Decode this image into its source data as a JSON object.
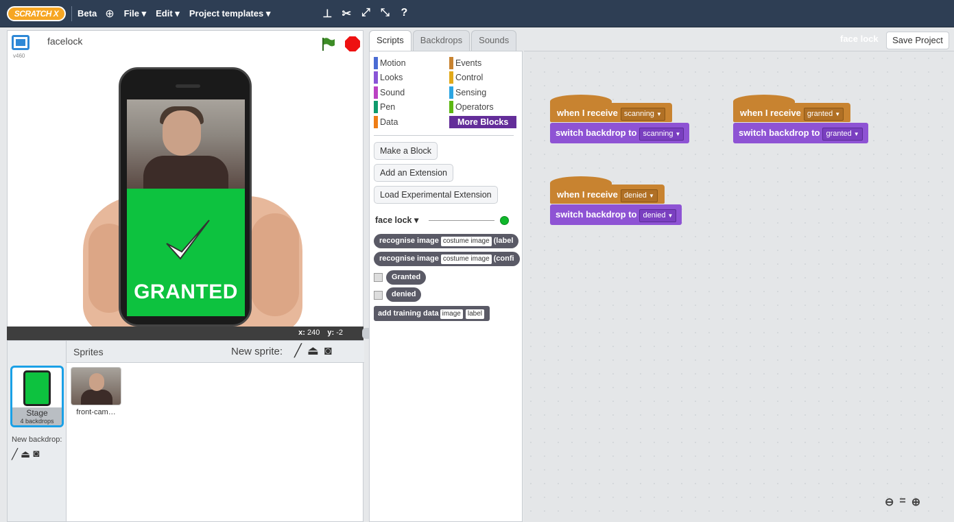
{
  "topbar": {
    "logo": "SCRATCH X",
    "beta": "Beta",
    "menus": [
      "File ▾",
      "Edit ▾",
      "Project templates ▾"
    ]
  },
  "stage": {
    "project_title": "facelock",
    "version": "v460",
    "coords": {
      "x_label": "x:",
      "x_value": "240",
      "y_label": "y:",
      "y_value": "-2"
    },
    "granted_text": "GRANTED"
  },
  "sprites_panel": {
    "title": "Sprites",
    "new_sprite": "New sprite:",
    "stage_tile": {
      "name": "Stage",
      "subtitle": "4 backdrops"
    },
    "new_backdrop": "New backdrop:",
    "sprites": [
      {
        "name": "front-cam…"
      }
    ]
  },
  "tabs": [
    "Scripts",
    "Backdrops",
    "Sounds"
  ],
  "palette": {
    "categories": [
      {
        "label": "Motion",
        "color": "#4a6cd4"
      },
      {
        "label": "Looks",
        "color": "#8a55d7"
      },
      {
        "label": "Sound",
        "color": "#bb42c3"
      },
      {
        "label": "Pen",
        "color": "#0e9a6c"
      },
      {
        "label": "Data",
        "color": "#ee7d16"
      },
      {
        "label": "Events",
        "color": "#c88330"
      },
      {
        "label": "Control",
        "color": "#e1a91a"
      },
      {
        "label": "Sensing",
        "color": "#2ca5e2"
      },
      {
        "label": "Operators",
        "color": "#5cb712"
      },
      {
        "label": "More Blocks",
        "color": "#632d99"
      }
    ],
    "buttons": [
      "Make a Block",
      "Add an Extension",
      "Load Experimental Extension"
    ],
    "extension_name": "face lock ▾",
    "blocks": {
      "reporter1": {
        "text": "recognise image",
        "slot": "costume image",
        "tail": "(label"
      },
      "reporter2": {
        "text": "recognise image",
        "slot": "costume image",
        "tail": "(confi"
      },
      "granted": "Granted",
      "denied": "denied",
      "add_training": {
        "text": "add training data",
        "slot1": "image",
        "slot2": "label"
      }
    }
  },
  "script_area": {
    "sprite_name": "face lock",
    "save_button": "Save Project",
    "scripts": [
      {
        "hat": "when I receive",
        "message": "scanning",
        "cmd": "switch backdrop to",
        "backdrop": "scanning"
      },
      {
        "hat": "when I receive",
        "message": "granted",
        "cmd": "switch backdrop to",
        "backdrop": "granted"
      },
      {
        "hat": "when I receive",
        "message": "denied",
        "cmd": "switch backdrop to",
        "backdrop": "denied"
      }
    ]
  },
  "icons": [
    "globe-icon",
    "stamp-icon",
    "cut-icon",
    "grow-icon",
    "shrink-icon",
    "help-icon",
    "paintbrush-icon",
    "upload-icon",
    "camera-icon",
    "zoom-out-icon",
    "zoom-reset-icon",
    "zoom-in-icon",
    "green-flag-icon",
    "stop-icon"
  ]
}
